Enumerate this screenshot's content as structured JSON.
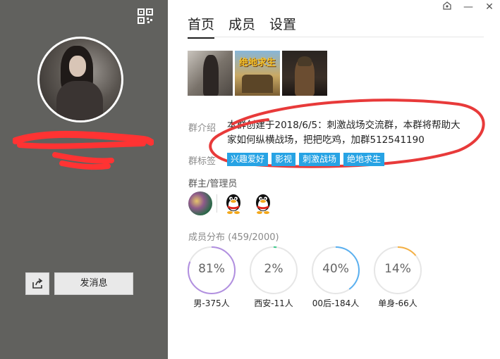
{
  "window": {
    "skin_icon": "skin-icon",
    "min_icon": "minimize-icon",
    "min_glyph": "—",
    "close_icon": "close-icon",
    "close_glyph": "✕"
  },
  "left": {
    "qr_icon": "qr-code-icon",
    "send_message": "发消息",
    "share_icon": "share-icon"
  },
  "tabs": [
    {
      "label": "首页",
      "active": true
    },
    {
      "label": "成员",
      "active": false
    },
    {
      "label": "设置",
      "active": false
    }
  ],
  "photos": [
    {
      "alt": "photo-1"
    },
    {
      "alt": "photo-2",
      "caption": "绝地求生"
    },
    {
      "alt": "photo-3"
    }
  ],
  "intro": {
    "label": "群介绍",
    "text": "本群创建于2018/6/5：刺激战场交流群，本群将帮助大家如何纵横战场，把把吃鸡，加群512541190"
  },
  "tags": {
    "label": "群标签",
    "items": [
      "兴趣爱好",
      "影视",
      "刺激战场",
      "绝地求生"
    ],
    "color": "#27a3e4"
  },
  "admins": {
    "label": "群主/管理员"
  },
  "distribution": {
    "label": "成员分布 (459/2000)",
    "items": [
      {
        "value": "81%",
        "fraction": 0.81,
        "caption": "男-375人",
        "color": "#b18fe0"
      },
      {
        "value": "2%",
        "fraction": 0.02,
        "caption": "西安-11人",
        "color": "#3cc98a"
      },
      {
        "value": "40%",
        "fraction": 0.4,
        "caption": "00后-184人",
        "color": "#5ab0f0"
      },
      {
        "value": "14%",
        "fraction": 0.14,
        "caption": "单身-66人",
        "color": "#f5b043"
      }
    ]
  }
}
